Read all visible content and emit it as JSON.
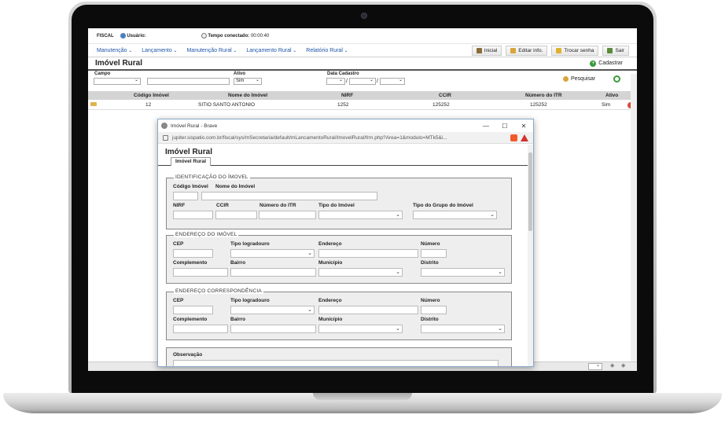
{
  "app": {
    "module": "FISCAL",
    "user_label": "Usuário:",
    "time_label": "Tempo conectado:",
    "time_value": "00:00:40"
  },
  "menu": {
    "items": [
      "Manutenção",
      "Lançamento",
      "Manutenção Rural",
      "Lançamento Rural",
      "Relatório Rural"
    ],
    "buttons": [
      "Inicial",
      "Editar info.",
      "Trocar senha",
      "Sair"
    ]
  },
  "page": {
    "title": "Imóvel Rural",
    "new_label": "Cadastrar"
  },
  "filters": {
    "campo_label": "Campo",
    "ativo_label": "Ativo",
    "ativo_value": "Sim",
    "data_label": "Data Cadastro",
    "search_label": "Pesquisar"
  },
  "table": {
    "columns": [
      "Código Imóvel",
      "Nome do Imóvel",
      "NIRF",
      "CCIR",
      "Número do ITR",
      "Ativo"
    ],
    "rows": [
      [
        "12",
        "SITIO SANTO ANTONIO",
        "1252",
        "125252",
        "125252",
        "Sim"
      ]
    ]
  },
  "popup": {
    "window_title": "Imóvel Rural - Brave",
    "url": "jupiter.sispatio.com.br/fiscal/sys/mSecretaria/default/mLancamentoRural/ImovelRural/frm.php?Area=1&modulo=MTk5&i...",
    "title": "Imóvel Rural",
    "tab": "Imóvel Rural",
    "sections": {
      "identificacao": {
        "legend": "IDENTIFICAÇÃO DO ÍMOVEL",
        "labels": [
          "Código Imóvel",
          "Nome do Imóvel",
          "NIRF",
          "CCIR",
          "Número do ITR",
          "Tipo do Imóvel",
          "Tipo do Grupo do Imóvel"
        ]
      },
      "endereco": {
        "legend": "ENDEREÇO DO IMÓVEL",
        "labels": [
          "CEP",
          "Tipo logradouro",
          "Endereço",
          "Número",
          "Complemento",
          "Bairro",
          "Município",
          "Distrito"
        ]
      },
      "correspondencia": {
        "legend": "ENDEREÇO CORRESPONDÊNCIA",
        "labels": [
          "CEP",
          "Tipo logradouro",
          "Endereço",
          "Número",
          "Complemento",
          "Bairro",
          "Município",
          "Distrito"
        ]
      },
      "observacao": {
        "label": "Observação"
      }
    }
  }
}
